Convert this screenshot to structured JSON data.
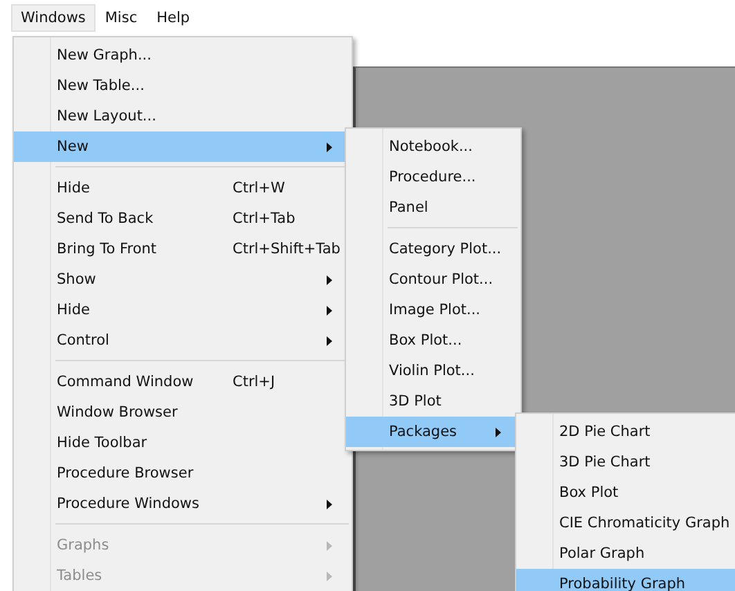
{
  "menubar": [
    {
      "label": "Windows",
      "selected": true
    },
    {
      "label": "Misc",
      "selected": false
    },
    {
      "label": "Help",
      "selected": false
    }
  ],
  "menus": [
    {
      "items": [
        {
          "kind": "item",
          "label": "New Graph...",
          "submenu": false,
          "disabled": false,
          "selected": false
        },
        {
          "kind": "item",
          "label": "New Table...",
          "submenu": false,
          "disabled": false,
          "selected": false
        },
        {
          "kind": "item",
          "label": "New Layout...",
          "submenu": false,
          "disabled": false,
          "selected": false
        },
        {
          "kind": "item",
          "label": "New",
          "submenu": true,
          "disabled": false,
          "selected": true
        },
        {
          "kind": "separator"
        },
        {
          "kind": "item",
          "label": "Hide",
          "shortcut": "Ctrl+W",
          "submenu": false,
          "disabled": false,
          "selected": false
        },
        {
          "kind": "item",
          "label": "Send To Back",
          "shortcut": "Ctrl+Tab",
          "submenu": false,
          "disabled": false,
          "selected": false
        },
        {
          "kind": "item",
          "label": "Bring To Front",
          "shortcut": "Ctrl+Shift+Tab",
          "submenu": false,
          "disabled": false,
          "selected": false
        },
        {
          "kind": "item",
          "label": "Show",
          "submenu": true,
          "disabled": false,
          "selected": false
        },
        {
          "kind": "item",
          "label": "Hide",
          "submenu": true,
          "disabled": false,
          "selected": false
        },
        {
          "kind": "item",
          "label": "Control",
          "submenu": true,
          "disabled": false,
          "selected": false
        },
        {
          "kind": "separator"
        },
        {
          "kind": "item",
          "label": "Command Window",
          "shortcut": "Ctrl+J",
          "submenu": false,
          "disabled": false,
          "selected": false
        },
        {
          "kind": "item",
          "label": "Window Browser",
          "submenu": false,
          "disabled": false,
          "selected": false
        },
        {
          "kind": "item",
          "label": "Hide Toolbar",
          "submenu": false,
          "disabled": false,
          "selected": false
        },
        {
          "kind": "item",
          "label": "Procedure Browser",
          "submenu": false,
          "disabled": false,
          "selected": false
        },
        {
          "kind": "item",
          "label": "Procedure Windows",
          "submenu": true,
          "disabled": false,
          "selected": false
        },
        {
          "kind": "separator"
        },
        {
          "kind": "item",
          "label": "Graphs",
          "submenu": true,
          "disabled": true,
          "selected": false
        },
        {
          "kind": "item",
          "label": "Tables",
          "submenu": true,
          "disabled": true,
          "selected": false
        }
      ]
    },
    {
      "items": [
        {
          "kind": "item",
          "label": "Notebook...",
          "submenu": false,
          "disabled": false,
          "selected": false
        },
        {
          "kind": "item",
          "label": "Procedure...",
          "submenu": false,
          "disabled": false,
          "selected": false
        },
        {
          "kind": "item",
          "label": "Panel",
          "submenu": false,
          "disabled": false,
          "selected": false
        },
        {
          "kind": "separator"
        },
        {
          "kind": "item",
          "label": "Category Plot...",
          "submenu": false,
          "disabled": false,
          "selected": false
        },
        {
          "kind": "item",
          "label": "Contour Plot...",
          "submenu": false,
          "disabled": false,
          "selected": false
        },
        {
          "kind": "item",
          "label": "Image Plot...",
          "submenu": false,
          "disabled": false,
          "selected": false
        },
        {
          "kind": "item",
          "label": "Box Plot...",
          "submenu": false,
          "disabled": false,
          "selected": false
        },
        {
          "kind": "item",
          "label": "Violin Plot...",
          "submenu": false,
          "disabled": false,
          "selected": false
        },
        {
          "kind": "item",
          "label": "3D Plot",
          "submenu": false,
          "disabled": false,
          "selected": false
        },
        {
          "kind": "item",
          "label": "Packages",
          "submenu": true,
          "disabled": false,
          "selected": true
        }
      ]
    },
    {
      "items": [
        {
          "kind": "item",
          "label": "2D Pie Chart",
          "submenu": false,
          "disabled": false,
          "selected": false
        },
        {
          "kind": "item",
          "label": "3D Pie Chart",
          "submenu": false,
          "disabled": false,
          "selected": false
        },
        {
          "kind": "item",
          "label": "Box Plot",
          "submenu": false,
          "disabled": false,
          "selected": false
        },
        {
          "kind": "item",
          "label": "CIE Chromaticity Graph",
          "submenu": false,
          "disabled": false,
          "selected": false
        },
        {
          "kind": "item",
          "label": "Polar Graph",
          "submenu": false,
          "disabled": false,
          "selected": false
        },
        {
          "kind": "item",
          "label": "Probability Graph",
          "submenu": false,
          "disabled": false,
          "selected": true
        }
      ]
    }
  ]
}
